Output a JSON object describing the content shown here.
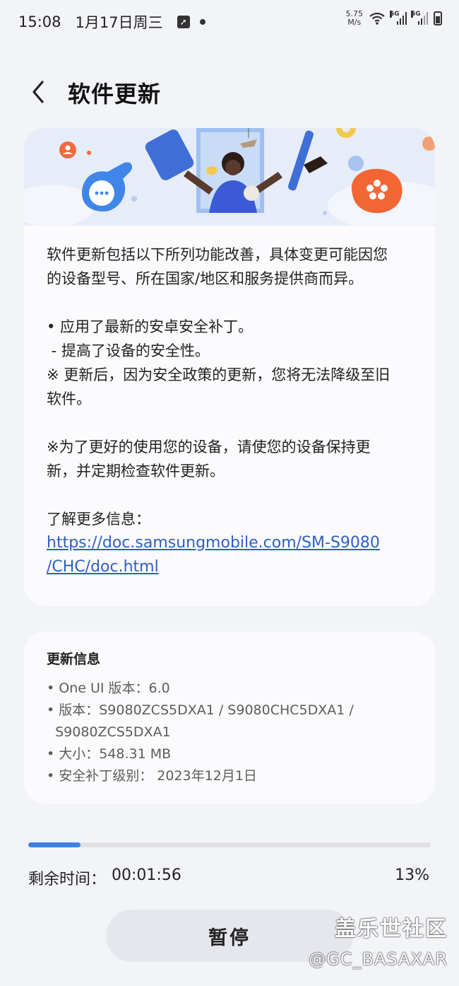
{
  "status_bar": {
    "time": "15:08",
    "date": "1月17日周三",
    "net_speed_value": "5.75",
    "net_speed_unit": "M/s",
    "signal_1_label": "5G",
    "signal_2_label": "5G"
  },
  "header": {
    "title": "软件更新"
  },
  "description": {
    "intro_line1": "软件更新包括以下所列功能改善，具体变更可能因您",
    "intro_line2": "的设备型号、所在国家/地区和服务提供商而异。",
    "bullet1": "• 应用了最新的安卓安全补丁。",
    "bullet1_sub": " - 提高了设备的安全性。",
    "note1_line1": "※ 更新后，因为安全政策的更新，您将无法降级至旧",
    "note1_line2": "软件。",
    "note2_line1": "※为了更好的使用您的设备，请使您的设备保持更",
    "note2_line2": "新，并定期检查软件更新。",
    "more_info_label": "了解更多信息：",
    "link_line1": "https://doc.samsungmobile.com/SM-S9080",
    "link_line2": "/CHC/doc.html"
  },
  "update_info": {
    "title": "更新信息",
    "one_ui": "• One UI 版本：6.0",
    "version_line1": "• 版本：S9080ZCS5DXA1 / S9080CHC5DXA1 /",
    "version_line2": "  S9080ZCS5DXA1",
    "size": "• 大小：548.31 MB",
    "patch_level": "• 安全补丁级别： 2023年12月1日"
  },
  "progress": {
    "percent_value": 13,
    "remaining_label": "剩余时间：",
    "remaining_value": "00:01:56",
    "percent_text": "13%",
    "accent_color": "#3e82e8"
  },
  "actions": {
    "pause_label": "暂停"
  },
  "watermark": {
    "site": "盖乐世社区",
    "user": "@GC_BASAXAR"
  },
  "icons": {
    "back": "chevron-left-icon",
    "chat": "chat-bubble-icon",
    "flower": "flower-icon",
    "person": "person-icon"
  }
}
